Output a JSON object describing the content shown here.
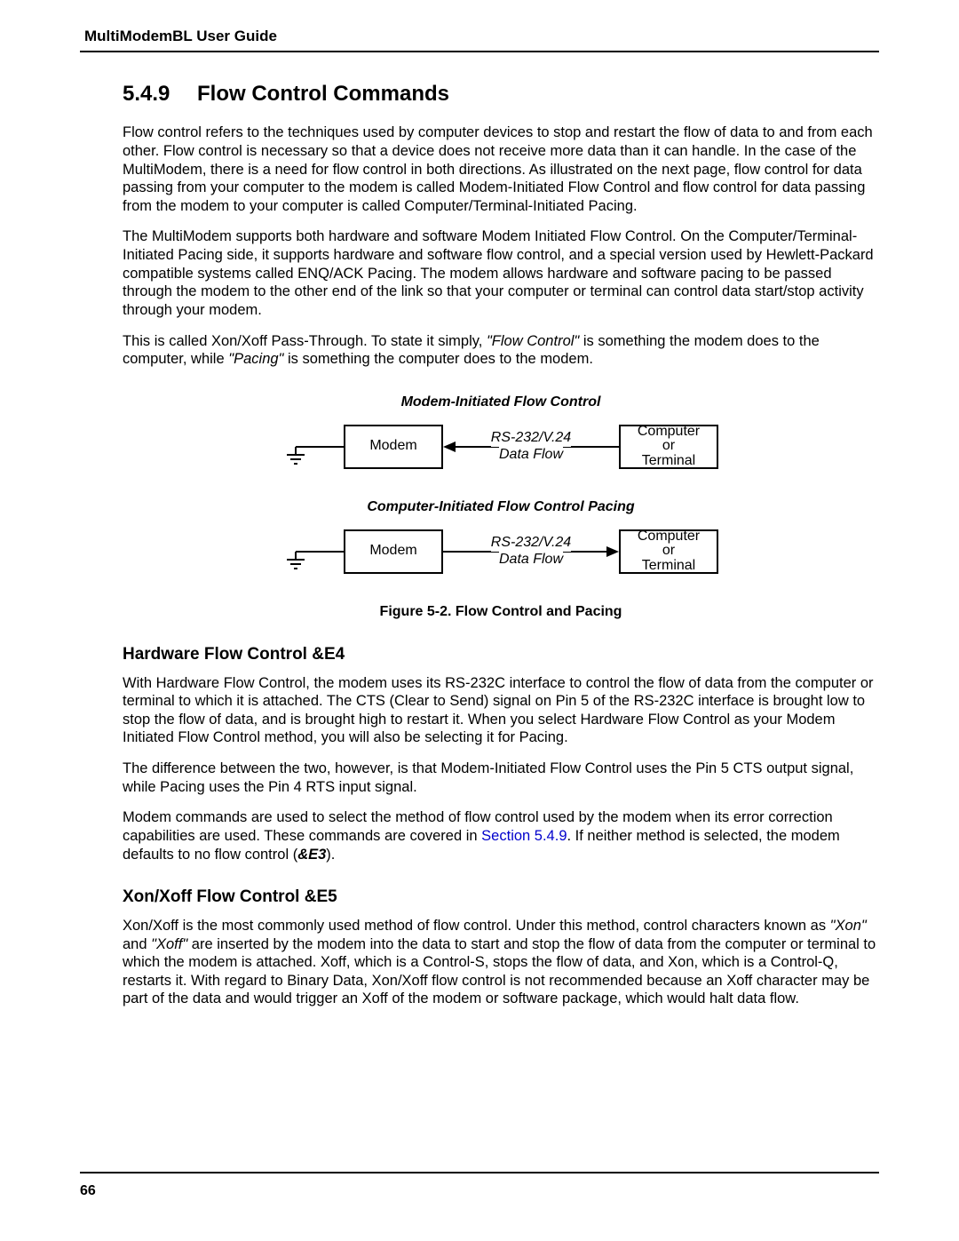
{
  "header": {
    "title": "MultiModemBL User Guide"
  },
  "section": {
    "number": "5.4.9",
    "title": "Flow Control Commands",
    "p1": "Flow control refers to the techniques used by computer devices to stop and restart the flow of data to and from each other. Flow control is necessary so that a device does not receive more data than it can handle. In the case of the MultiModem, there is a need for flow control in both directions. As illustrated on the next page, flow control for data passing from your computer to the modem is called Modem-Initiated Flow Control and flow control for data passing from the modem to your computer is called Computer/Terminal-Initiated Pacing.",
    "p2": "The MultiModem supports both hardware and software Modem Initiated Flow Control. On the Computer/Terminal-Initiated Pacing side, it supports hardware and software flow control, and a special version used by Hewlett-Packard compatible systems called ENQ/ACK Pacing. The modem allows hardware and software pacing to be passed through the modem to the other end of the link so that your computer or terminal can control data start/stop activity through your modem.",
    "p3_a": "This is called Xon/Xoff Pass-Through. To state it simply, ",
    "p3_q1": "\"Flow Control\"",
    "p3_b": " is something the modem does to the computer, while ",
    "p3_q2": "\"Pacing\"",
    "p3_c": " is something the computer does to the modem."
  },
  "diagram": {
    "title1": "Modem-Initiated Flow Control",
    "title2": "Computer-Initiated Flow Control Pacing",
    "modem": "Modem",
    "comp1": "Computer",
    "comp2": "or",
    "comp3": "Terminal",
    "mid1": "RS-232/V.24",
    "mid2": "Data Flow",
    "caption": "Figure 5-2. Flow Control and Pacing"
  },
  "hw": {
    "title": "Hardware Flow Control &E4",
    "p1": "With Hardware Flow Control, the modem uses its RS-232C interface to control the flow of data from the computer or terminal to which it is attached. The CTS (Clear to Send) signal on Pin 5 of the RS-232C interface is brought low to stop the flow of data, and is brought high to restart it. When you select Hardware Flow Control as your Modem Initiated Flow Control method, you will also be selecting it for Pacing.",
    "p2": "The difference between the two, however, is that Modem-Initiated Flow Control uses the Pin 5 CTS output signal, while Pacing uses the Pin 4 RTS input signal.",
    "p3_a": "Modem commands are used to select the method of flow control used by the modem when its error correction capabilities are used. These commands are covered in ",
    "p3_link": "Section 5.4.9",
    "p3_b": ". If neither method is selected, the modem defaults to no flow control (",
    "p3_cmd": "&E3",
    "p3_c": ")."
  },
  "xon": {
    "title": "Xon/Xoff Flow Control &E5",
    "p1_a": "Xon/Xoff is the most commonly used method of flow control. Under this method, control characters known as ",
    "p1_q1": "\"Xon\"",
    "p1_b": " and ",
    "p1_q2": "\"Xoff\"",
    "p1_c": " are inserted by the modem into the data to start and stop the flow of data from the computer or terminal to which the modem is attached. Xoff, which is a Control-S, stops the flow of data, and Xon, which is a Control-Q, restarts it. With regard to Binary Data, Xon/Xoff flow control is not recommended because an Xoff character may be part of the data and would trigger an Xoff of the modem or software package, which would halt data flow."
  },
  "footer": {
    "page": "66"
  }
}
